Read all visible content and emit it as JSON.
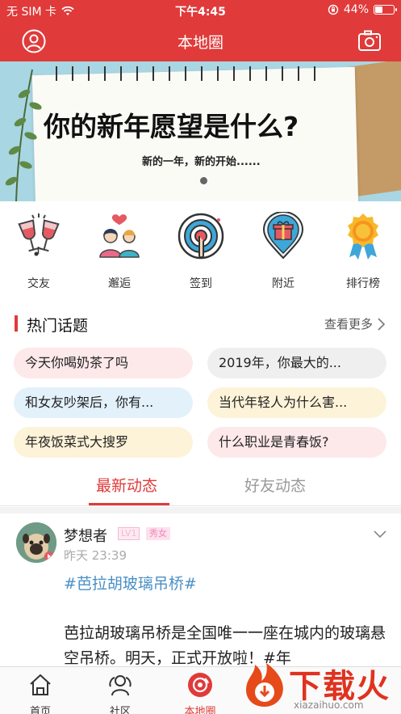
{
  "status_bar": {
    "carrier": "无 SIM 卡",
    "time": "下午4:45",
    "battery_percent": "44%",
    "battery_level": 0.44,
    "icons": [
      "wifi-icon",
      "orientation-lock-icon",
      "battery-icon"
    ]
  },
  "nav": {
    "title": "本地圈",
    "left_icon": "user-avatar-icon",
    "right_icon": "camera-icon"
  },
  "banner": {
    "headline": "你的新年愿望是什么?",
    "subline": "新的一年，新的开始......"
  },
  "quick_actions": [
    {
      "label": "交友",
      "icon": "wine-glasses-icon"
    },
    {
      "label": "邂逅",
      "icon": "couple-heart-icon"
    },
    {
      "label": "签到",
      "icon": "target-check-in-icon"
    },
    {
      "label": "附近",
      "icon": "gift-pin-icon"
    },
    {
      "label": "排行榜",
      "icon": "medal-icon"
    }
  ],
  "hot_topics": {
    "title": "热门话题",
    "more": "查看更多",
    "items": [
      "今天你喝奶茶了吗",
      "2019年，你最大的...",
      "和女友吵架后，你有...",
      "当代年轻人为什么害...",
      "年夜饭菜式大搜罗",
      "什么职业是青春饭?"
    ]
  },
  "tabs": [
    {
      "label": "最新动态",
      "active": true
    },
    {
      "label": "好友动态",
      "active": false
    }
  ],
  "post": {
    "author": "梦想者",
    "level": "LV1",
    "tag": "秀女",
    "time": "昨天 23:39",
    "hashtag": "#芭拉胡玻璃吊桥#",
    "text": "芭拉胡玻璃吊桥是全国唯一一座在城内的玻璃悬空吊桥。明天，正式开放啦！#年"
  },
  "bottom_nav": [
    {
      "label": "首页",
      "icon": "home-icon",
      "active": false
    },
    {
      "label": "社区",
      "icon": "community-icon",
      "active": false
    },
    {
      "label": "本地圈",
      "icon": "local-circle-icon",
      "active": true
    }
  ],
  "watermark": {
    "text": "下载火",
    "url": "xiazaihuo.com"
  },
  "colors": {
    "brand_red": "#e03a3a",
    "hashtag_blue": "#4a8fc5"
  }
}
